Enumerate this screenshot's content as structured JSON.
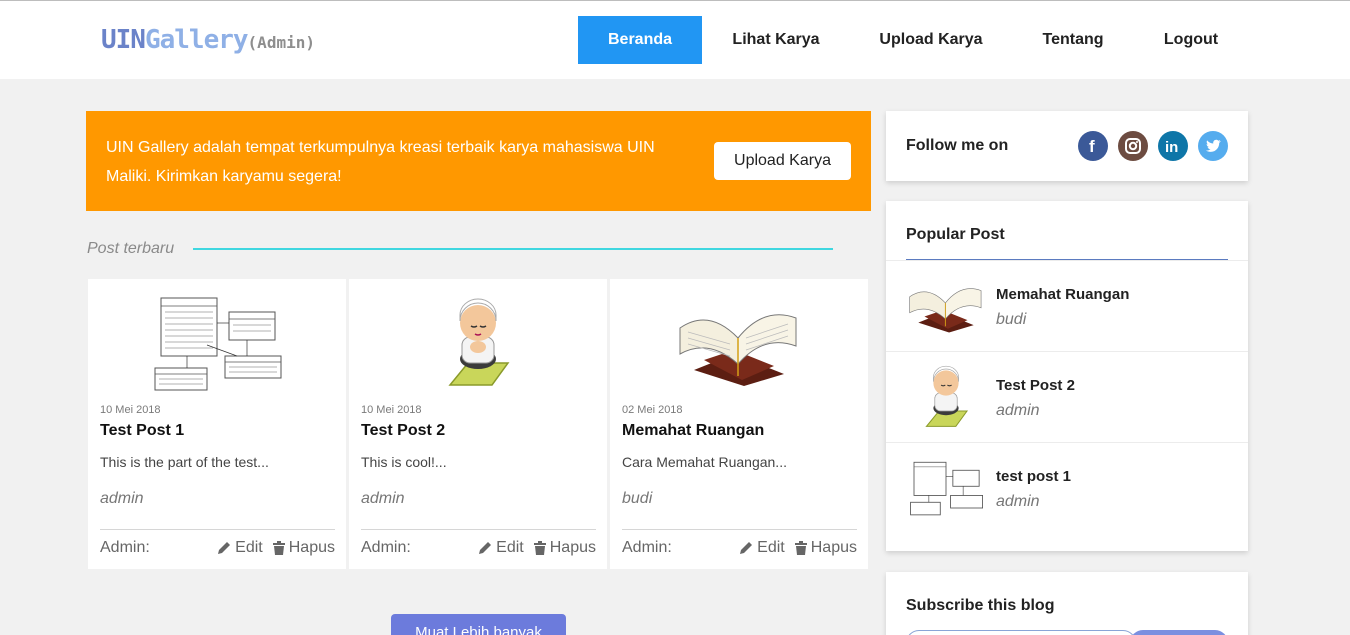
{
  "header": {
    "logo": {
      "part1": "UIN",
      "part2": "Gallery",
      "part3": "(Admin)"
    },
    "nav": [
      {
        "label": "Beranda",
        "active": true
      },
      {
        "label": "Lihat Karya",
        "active": false
      },
      {
        "label": "Upload Karya",
        "active": false
      },
      {
        "label": "Tentang",
        "active": false
      },
      {
        "label": "Logout",
        "active": false
      }
    ]
  },
  "banner": {
    "text": "UIN Gallery adalah tempat terkumpulnya kreasi terbaik karya mahasiswa UIN Maliki. Kirimkan karyamu segera!",
    "button": "Upload Karya"
  },
  "posts": {
    "section_title": "Post terbaru",
    "items": [
      {
        "date": "10 Mei 2018",
        "title": "Test Post 1",
        "excerpt": "This is the part of the test...",
        "author": "admin",
        "admin_label": "Admin:",
        "edit": "Edit",
        "delete": "Hapus",
        "image": "erd-diagram"
      },
      {
        "date": "10 Mei 2018",
        "title": "Test Post 2",
        "excerpt": "This is cool!...",
        "author": "admin",
        "admin_label": "Admin:",
        "edit": "Edit",
        "delete": "Hapus",
        "image": "praying-boy"
      },
      {
        "date": "02 Mei 2018",
        "title": "Memahat Ruangan",
        "excerpt": "Cara Memahat Ruangan...",
        "author": "budi",
        "admin_label": "Admin:",
        "edit": "Edit",
        "delete": "Hapus",
        "image": "open-book-stand"
      }
    ],
    "load_more": "Muat Lebih banyak"
  },
  "sidebar": {
    "follow_label": "Follow me on",
    "social": [
      {
        "icon": "facebook-icon",
        "color": "#3b5998"
      },
      {
        "icon": "instagram-icon",
        "color": "#6d4c41"
      },
      {
        "icon": "linkedin-icon",
        "color": "#0e76a8"
      },
      {
        "icon": "twitter-icon",
        "color": "#55acee"
      }
    ],
    "popular_title": "Popular Post",
    "popular": [
      {
        "title": "Memahat Ruangan",
        "author": "budi",
        "image": "open-book-stand"
      },
      {
        "title": "Test Post 2",
        "author": "admin",
        "image": "praying-boy"
      },
      {
        "title": "test post 1",
        "author": "admin",
        "image": "erd-diagram"
      }
    ],
    "subscribe_title": "Subscribe this blog"
  },
  "colors": {
    "accent": "#2196f3",
    "banner": "#ff9800",
    "section_line": "#3fd7e0",
    "load_more": "#6c7bdc"
  }
}
